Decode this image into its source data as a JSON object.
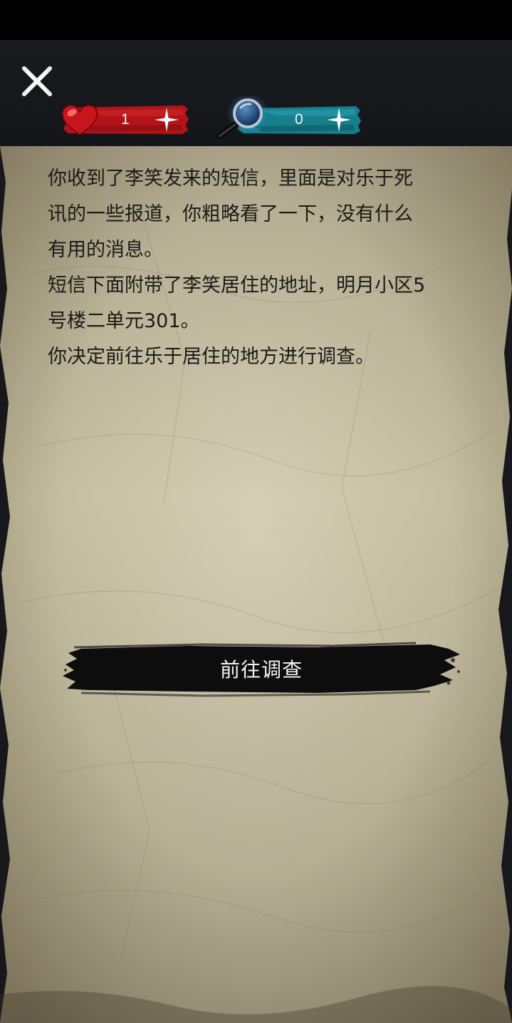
{
  "hud": {
    "health_value": "1",
    "clue_value": "0",
    "health_color": "#c8121a",
    "clue_color": "#1d8c9a"
  },
  "story": {
    "lines": [
      "你收到了李笑发来的短信，里面是对乐于死",
      "讯的一些报道，你粗略看了一下，没有什么",
      "有用的消息。",
      "短信下面附带了李笑居住的地址，明月小区5",
      "号楼二单元301。",
      "你决定前往乐于居住的地方进行调查。"
    ]
  },
  "action": {
    "label": "前往调查"
  },
  "colors": {
    "paper": "#cfc7ad",
    "paper_dark": "#8f8468",
    "ink": "#0d0d0d"
  }
}
